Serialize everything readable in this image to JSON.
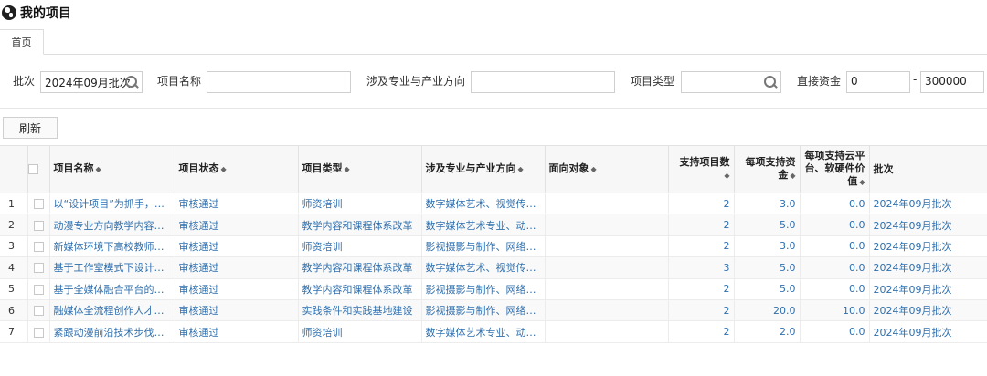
{
  "app": {
    "title": "我的项目",
    "logo_icon": "globe-icon"
  },
  "tabs": [
    {
      "label": "首页"
    }
  ],
  "filters": {
    "batch_label": "批次",
    "batch_value": "2024年09月批次",
    "name_label": "项目名称",
    "name_value": "",
    "major_label": "涉及专业与产业方向",
    "major_value": "",
    "type_label": "项目类型",
    "type_value": "",
    "fund_label": "直接资金",
    "fund_min": "0",
    "fund_sep": "-",
    "fund_max": "300000"
  },
  "toolbar": {
    "refresh_label": "刷新"
  },
  "table": {
    "sort_icon": "sort-icon",
    "columns": [
      {
        "label": "项目名称",
        "sortable": true
      },
      {
        "label": "项目状态",
        "sortable": true
      },
      {
        "label": "项目类型",
        "sortable": true
      },
      {
        "label": "涉及专业与产业方向",
        "sortable": true
      },
      {
        "label": "面向对象",
        "sortable": true
      },
      {
        "label": "支持项目数",
        "sortable": true
      },
      {
        "label": "每项支持资金",
        "sortable": true
      },
      {
        "label": "每项支持云平台、软硬件价值",
        "sortable": true
      },
      {
        "label": "批次",
        "sortable": false
      }
    ],
    "rows": [
      {
        "index": "1",
        "name": "以“设计项目”为抓手，提…",
        "status": "审核通过",
        "type": "师资培训",
        "major": "数字媒体艺术、视觉传…",
        "target": "",
        "count": "2",
        "fund": "3.0",
        "value": "0.0",
        "batch": "2024年09月批次"
      },
      {
        "index": "2",
        "name": "动漫专业方向教学内容…",
        "status": "审核通过",
        "type": "教学内容和课程体系改革",
        "major": "数字媒体艺术专业、动…",
        "target": "",
        "count": "2",
        "fund": "5.0",
        "value": "0.0",
        "batch": "2024年09月批次"
      },
      {
        "index": "3",
        "name": "新媒体环境下高校教师…",
        "status": "审核通过",
        "type": "师资培训",
        "major": "影视摄影与制作、网络…",
        "target": "",
        "count": "2",
        "fund": "3.0",
        "value": "0.0",
        "batch": "2024年09月批次"
      },
      {
        "index": "4",
        "name": "基于工作室模式下设计…",
        "status": "审核通过",
        "type": "教学内容和课程体系改革",
        "major": "数字媒体艺术、视觉传…",
        "target": "",
        "count": "3",
        "fund": "5.0",
        "value": "0.0",
        "batch": "2024年09月批次"
      },
      {
        "index": "5",
        "name": "基于全媒体融合平台的…",
        "status": "审核通过",
        "type": "教学内容和课程体系改革",
        "major": "影视摄影与制作、网络…",
        "target": "",
        "count": "2",
        "fund": "5.0",
        "value": "0.0",
        "batch": "2024年09月批次"
      },
      {
        "index": "6",
        "name": "融媒体全流程创作人才…",
        "status": "审核通过",
        "type": "实践条件和实践基地建设",
        "major": "影视摄影与制作、网络…",
        "target": "",
        "count": "2",
        "fund": "20.0",
        "value": "10.0",
        "batch": "2024年09月批次"
      },
      {
        "index": "7",
        "name": "紧跟动漫前沿技术步伐…",
        "status": "审核通过",
        "type": "师资培训",
        "major": "数字媒体艺术专业、动…",
        "target": "",
        "count": "2",
        "fund": "2.0",
        "value": "0.0",
        "batch": "2024年09月批次"
      }
    ]
  }
}
